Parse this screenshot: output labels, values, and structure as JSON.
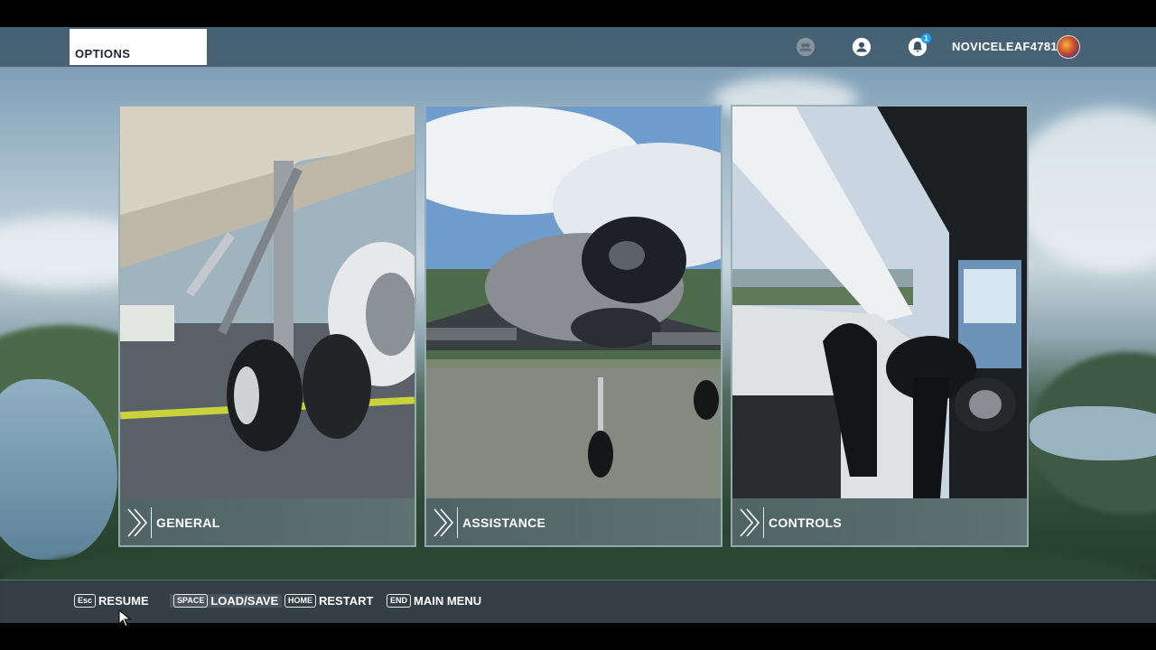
{
  "header": {
    "tab_title": "OPTIONS",
    "username": "NOVICELEAF4781",
    "notification_count": "1",
    "icons": [
      "friends-icon",
      "profile-icon",
      "notifications-icon",
      "avatar"
    ]
  },
  "cards": [
    {
      "label": "GENERAL",
      "image": "landing-gear-image"
    },
    {
      "label": "ASSISTANCE",
      "image": "propeller-plane-image"
    },
    {
      "label": "CONTROLS",
      "image": "cockpit-image"
    }
  ],
  "footer": {
    "actions": [
      {
        "key": "Esc",
        "label": "RESUME"
      },
      {
        "key": "SPACE",
        "label": "LOAD/SAVE"
      },
      {
        "key": "HOME",
        "label": "RESTART"
      },
      {
        "key": "END",
        "label": "MAIN MENU"
      }
    ]
  },
  "colors": {
    "accent": "#1ea1ff",
    "bar": "#3a5264",
    "tab": "#ffffff"
  }
}
